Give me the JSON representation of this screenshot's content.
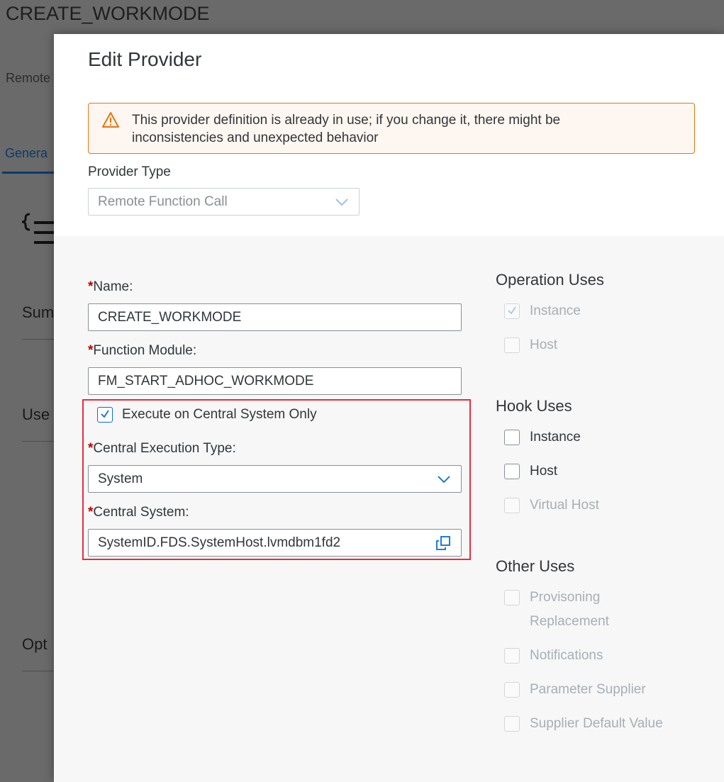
{
  "background": {
    "title": "CREATE_WORKMODE",
    "subtitle": "Remote",
    "tab": "Genera",
    "sections": [
      "Sum",
      "Use",
      "Opt"
    ]
  },
  "dialog": {
    "title": "Edit Provider",
    "warning": "This provider definition is already in use; if you change it, there might be inconsistencies and unexpected behavior",
    "provider_type": {
      "label": "Provider Type",
      "value": "Remote Function Call"
    },
    "required_marker": "*",
    "name": {
      "label": "Name:",
      "value": "CREATE_WORKMODE"
    },
    "function_module": {
      "label": "Function Module:",
      "value": "FM_START_ADHOC_WORKMODE"
    },
    "execute_central": {
      "label": "Execute on Central System Only",
      "checked": true
    },
    "central_execution_type": {
      "label": "Central Execution Type:",
      "value": "System"
    },
    "central_system": {
      "label": "Central System:",
      "value": "SystemID.FDS.SystemHost.lvmdbm1fd2"
    },
    "operation_uses": {
      "title": "Operation Uses",
      "items": [
        {
          "label": "Instance",
          "checked": true,
          "enabled": false
        },
        {
          "label": "Host",
          "checked": false,
          "enabled": false
        }
      ]
    },
    "hook_uses": {
      "title": "Hook Uses",
      "items": [
        {
          "label": "Instance",
          "checked": false,
          "enabled": true
        },
        {
          "label": "Host",
          "checked": false,
          "enabled": true
        },
        {
          "label": "Virtual Host",
          "checked": false,
          "enabled": false
        }
      ]
    },
    "other_uses": {
      "title": "Other Uses",
      "items": [
        {
          "label_line1": "Provisoning",
          "label_line2": "Replacement",
          "checked": false,
          "enabled": false
        },
        {
          "label": "Notifications",
          "checked": false,
          "enabled": false
        },
        {
          "label": "Parameter Supplier",
          "checked": false,
          "enabled": false
        },
        {
          "label": "Supplier Default Value",
          "checked": false,
          "enabled": false
        }
      ]
    }
  },
  "colors": {
    "accent": "#0a6ed1",
    "warning": "#e9730c",
    "required": "#bb0000",
    "highlight": "#e52d3e"
  },
  "icons": {
    "warning": "warning-triangle-icon",
    "dropdown": "chevron-down-icon",
    "value_help": "value-help-icon",
    "check": "checkmark-icon"
  }
}
